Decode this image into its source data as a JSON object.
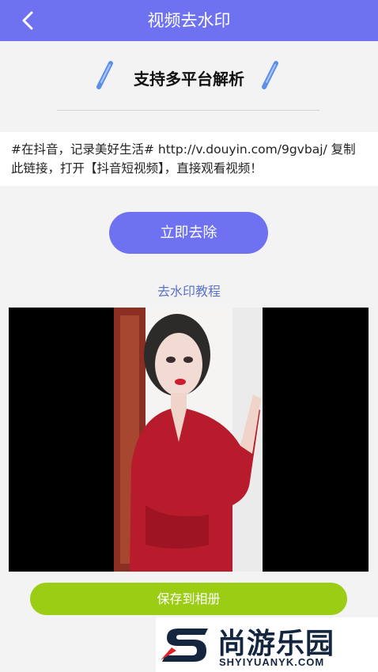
{
  "header": {
    "title": "视频去水印"
  },
  "slogan": {
    "text": "支持多平台解析"
  },
  "link_input": {
    "value": "#在抖音，记录美好生活# http://v.douyin.com/9gvbaj/ 复制此链接，打开【抖音短视频】，直接观看视频！"
  },
  "actions": {
    "remove_label": "立即去除",
    "tutorial_label": "去水印教程",
    "save_label": "保存到相册"
  },
  "watermark": {
    "name_cn": "尚游乐园",
    "site": "SHYIYUANYK.COM"
  },
  "colors": {
    "accent": "#6e72f0",
    "save_green": "#9acd13",
    "tutorial_link": "#5b73c8"
  }
}
